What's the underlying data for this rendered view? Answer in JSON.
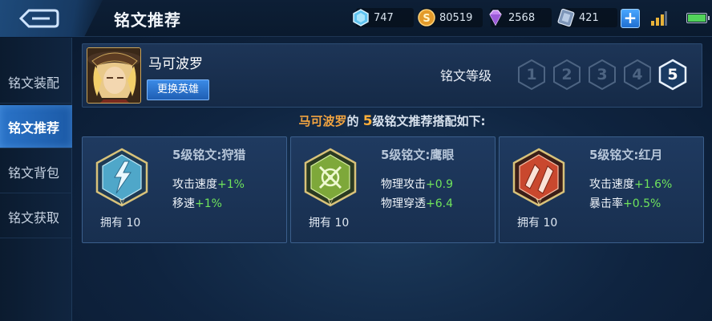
{
  "header": {
    "title": "铭文推荐",
    "currencies": [
      {
        "icon": "diamond-icon",
        "value": "747"
      },
      {
        "icon": "gold-coin-icon",
        "value": "80519"
      },
      {
        "icon": "crystal-icon",
        "value": "2568"
      },
      {
        "icon": "voucher-icon",
        "value": "421"
      }
    ],
    "plus_label": "+"
  },
  "sidebar": {
    "items": [
      {
        "label": "铭文装配",
        "active": false
      },
      {
        "label": "铭文推荐",
        "active": true
      },
      {
        "label": "铭文背包",
        "active": false
      },
      {
        "label": "铭文获取",
        "active": false
      }
    ]
  },
  "hero": {
    "name": "马可波罗",
    "change_button": "更换英雄",
    "level_label": "铭文等级",
    "levels": [
      "1",
      "2",
      "3",
      "4",
      "5"
    ],
    "selected_level": "5"
  },
  "recommendation": {
    "hero_name": "马可波罗",
    "connector": "的",
    "level": "5",
    "suffix": "级铭文推荐搭配如下:"
  },
  "runes": [
    {
      "title": "5级铭文:狩猎",
      "color": "#7fd0f0",
      "stats": [
        {
          "name": "攻击速度",
          "value": "+1%"
        },
        {
          "name": "移速",
          "value": "+1%"
        }
      ],
      "owned": "拥有 10"
    },
    {
      "title": "5级铭文:鹰眼",
      "color": "#9ed24a",
      "stats": [
        {
          "name": "物理攻击",
          "value": "+0.9"
        },
        {
          "name": "物理穿透",
          "value": "+6.4"
        }
      ],
      "owned": "拥有 10"
    },
    {
      "title": "5级铭文:红月",
      "color": "#e0583a",
      "stats": [
        {
          "name": "攻击速度",
          "value": "+1.6%"
        },
        {
          "name": "暴击率",
          "value": "+0.5%"
        }
      ],
      "owned": "拥有 10"
    }
  ]
}
